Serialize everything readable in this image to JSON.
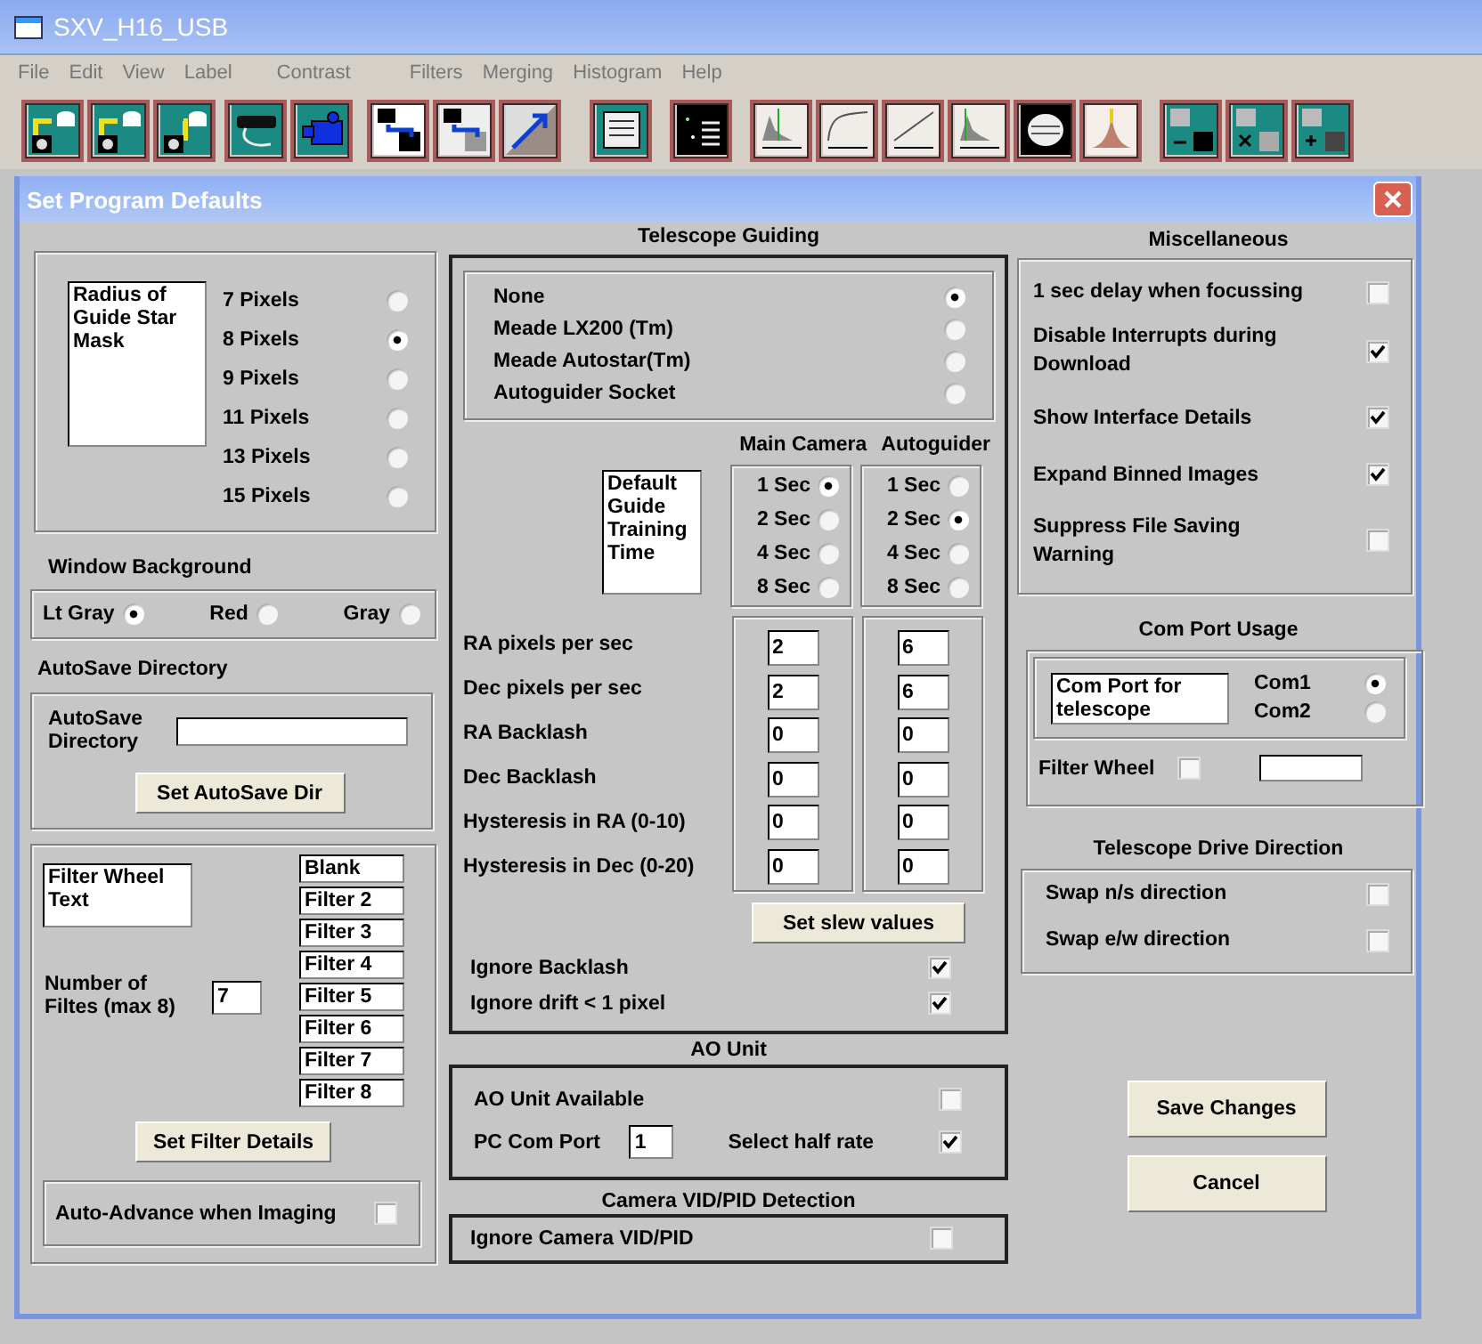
{
  "window": {
    "title": "SXV_H16_USB"
  },
  "menu": [
    "File",
    "Edit",
    "View",
    "Label",
    "Contrast",
    "Filters",
    "Merging",
    "Histogram",
    "Help"
  ],
  "dialog": {
    "title": "Set Program Defaults"
  },
  "guide_star_mask": {
    "label": "Radius of Guide Star Mask",
    "options": [
      {
        "label": "7 Pixels",
        "selected": false
      },
      {
        "label": "8 Pixels",
        "selected": true
      },
      {
        "label": "9 Pixels",
        "selected": false
      },
      {
        "label": "11 Pixels",
        "selected": false
      },
      {
        "label": "13 Pixels",
        "selected": false
      },
      {
        "label": "15 Pixels",
        "selected": false
      }
    ]
  },
  "window_background": {
    "title": "Window Background",
    "options": [
      {
        "label": "Lt Gray",
        "selected": true
      },
      {
        "label": "Red",
        "selected": false
      },
      {
        "label": "Gray",
        "selected": false
      }
    ]
  },
  "autosave": {
    "title": "AutoSave Directory",
    "label": "AutoSave Directory",
    "button": "Set AutoSave Dir"
  },
  "filter_wheel": {
    "label": "Filter Wheel Text",
    "count_label": "Number of Filtes (max 8)",
    "count": "7",
    "filters": [
      "Blank",
      "Filter 2",
      "Filter 3",
      "Filter 4",
      "Filter 5",
      "Filter 6",
      "Filter 7",
      "Filter 8"
    ],
    "button": "Set Filter Details",
    "auto_advance": {
      "label": "Auto-Advance when Imaging",
      "checked": false
    }
  },
  "telescope_guiding": {
    "title": "Telescope Guiding",
    "mounts": [
      {
        "label": "None",
        "selected": true
      },
      {
        "label": "Meade LX200 (Tm)",
        "selected": false
      },
      {
        "label": "Meade Autostar(Tm)",
        "selected": false
      },
      {
        "label": "Autoguider Socket",
        "selected": false
      }
    ],
    "column_headers": [
      "Main Camera",
      "Autoguider"
    ],
    "training_label": "Default Guide Training Time",
    "main_times": [
      {
        "label": "1 Sec",
        "selected": true
      },
      {
        "label": "2 Sec",
        "selected": false
      },
      {
        "label": "4 Sec",
        "selected": false
      },
      {
        "label": "8 Sec",
        "selected": false
      }
    ],
    "guider_times": [
      {
        "label": "1 Sec",
        "selected": false
      },
      {
        "label": "2 Sec",
        "selected": true
      },
      {
        "label": "4 Sec",
        "selected": false
      },
      {
        "label": "8 Sec",
        "selected": false
      }
    ],
    "parameters": [
      {
        "label": "RA pixels per sec",
        "main": "2",
        "guider": "6"
      },
      {
        "label": "Dec pixels per sec",
        "main": "2",
        "guider": "6"
      },
      {
        "label": "RA Backlash",
        "main": "0",
        "guider": "0"
      },
      {
        "label": "Dec Backlash",
        "main": "0",
        "guider": "0"
      },
      {
        "label": "Hysteresis in RA (0-10)",
        "main": "0",
        "guider": "0"
      },
      {
        "label": "Hysteresis in Dec (0-20)",
        "main": "0",
        "guider": "0"
      }
    ],
    "button": "Set slew values",
    "options": [
      {
        "label": "Ignore Backlash",
        "checked": true
      },
      {
        "label": "Ignore drift < 1 pixel",
        "checked": true
      }
    ]
  },
  "ao_unit": {
    "title": "AO Unit",
    "available": {
      "label": "AO Unit Available",
      "checked": false
    },
    "com_port_label": "PC Com Port",
    "com_port": "1",
    "half_rate": {
      "label": "Select half rate",
      "checked": true
    }
  },
  "vid_pid": {
    "title": "Camera VID/PID Detection",
    "ignore": {
      "label": "Ignore Camera VID/PID",
      "checked": false
    }
  },
  "miscellaneous": {
    "title": "Miscellaneous",
    "options": [
      {
        "label": "1 sec delay when focussing",
        "checked": false
      },
      {
        "label": "Disable Interrupts during Download",
        "checked": true
      },
      {
        "label": "Show Interface Details",
        "checked": true
      },
      {
        "label": "Expand Binned Images",
        "checked": true
      },
      {
        "label": "Suppress File Saving Warning",
        "checked": false
      }
    ]
  },
  "com_port_usage": {
    "title": "Com Port Usage",
    "label": "Com Port for telescope",
    "ports": [
      {
        "label": "Com1",
        "selected": true
      },
      {
        "label": "Com2",
        "selected": false
      }
    ],
    "filter_wheel": {
      "label": "Filter Wheel",
      "checked": false
    }
  },
  "drive_direction": {
    "title": "Telescope Drive Direction",
    "options": [
      {
        "label": "Swap n/s direction",
        "checked": false
      },
      {
        "label": "Swap e/w direction",
        "checked": false
      }
    ]
  },
  "buttons": [
    "Save Changes",
    "Cancel"
  ]
}
